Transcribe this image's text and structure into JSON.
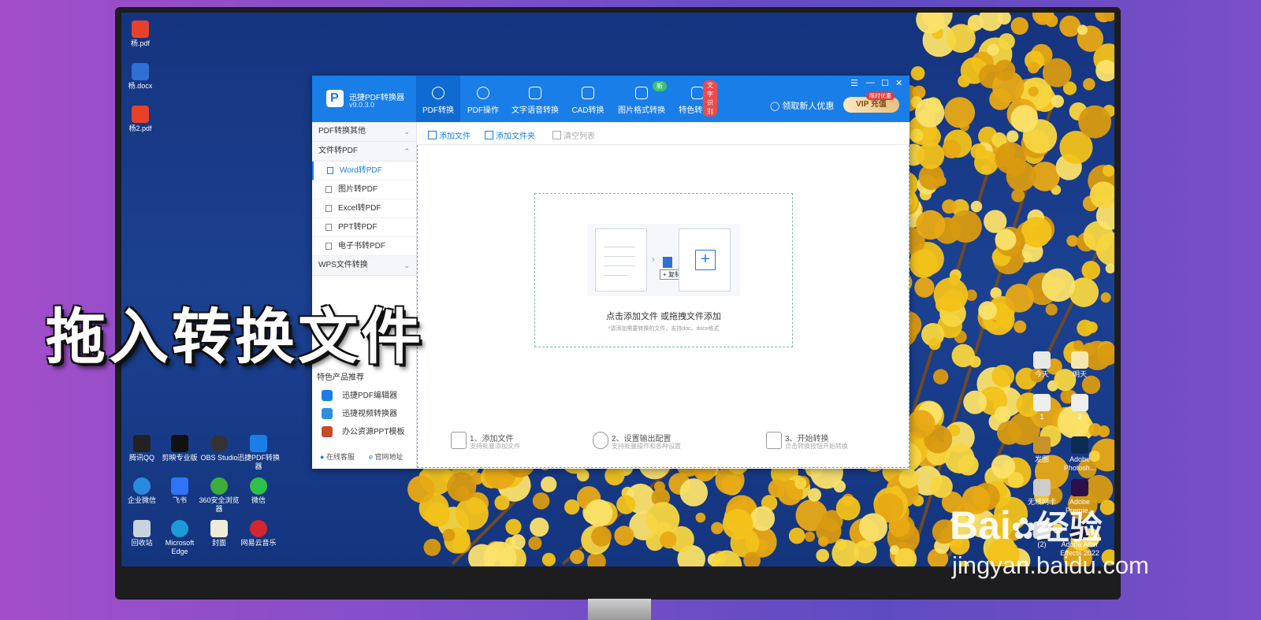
{
  "overlay": {
    "headline": "拖入转换文件"
  },
  "watermark": {
    "logo": "Bai",
    "logo_cn": "经验",
    "url": "jingyan.baidu.com"
  },
  "desktop": {
    "top_icons": [
      {
        "label": "杨.pdf",
        "color": "#e8412b"
      },
      {
        "label": "杨.docx",
        "color": "#2f6fd6"
      },
      {
        "label": "杨2.pdf",
        "color": "#e8412b"
      }
    ],
    "bottom_icons": [
      {
        "label": "腾讯QQ",
        "color": "#222222"
      },
      {
        "label": "剪映专业版",
        "color": "#111111"
      },
      {
        "label": "OBS Studio",
        "color": "#333333"
      },
      {
        "label": "迅捷PDF转换器",
        "color": "#1a7ee8"
      },
      {
        "label": "企业微信",
        "color": "#2a8ae0"
      },
      {
        "label": "飞书",
        "color": "#2f74f5"
      },
      {
        "label": "360安全浏览器",
        "color": "#3dae3a"
      },
      {
        "label": "微信",
        "color": "#2ec14a"
      },
      {
        "label": "回收站",
        "color": "#c9d3de"
      },
      {
        "label": "Microsoft Edge",
        "color": "#1c9ad6"
      },
      {
        "label": "封面",
        "color": "#f0ead8"
      },
      {
        "label": "网易云音乐",
        "color": "#d3262f"
      }
    ],
    "right_icons": [
      {
        "label": "今天",
        "color": "#e8e8e8"
      },
      {
        "label": "明天",
        "color": "#f4e7b0"
      },
      {
        "label": "1",
        "color": "#eeeeee"
      },
      {
        "label": "2",
        "color": "#eeeeee"
      },
      {
        "label": "发图",
        "color": "#c8922a"
      },
      {
        "label": "Adobe Photosh...",
        "color": "#0d2c52"
      },
      {
        "label": "无线网卡",
        "color": "#cccccc"
      },
      {
        "label": "Adobe Premie...",
        "color": "#2a0f4a"
      },
      {
        "label": "(2)",
        "color": "#dddddd"
      },
      {
        "label": "Adobe After Effects 2022",
        "color": "#1a1b47"
      }
    ]
  },
  "app": {
    "name": "迅捷PDF转换器",
    "version": "v9.0.3.0",
    "nav": [
      {
        "label": "PDF转换"
      },
      {
        "label": "PDF操作"
      },
      {
        "label": "文字语音转换"
      },
      {
        "label": "CAD转换"
      },
      {
        "label": "图片格式转换"
      },
      {
        "label": "特色转换"
      }
    ],
    "badge_new": "新",
    "badge_ocr": "文字识别",
    "promo": "领取新人优惠",
    "vip_label": "VIP 充值",
    "vip_tag": "限时优惠",
    "window_controls": {
      "menu": "☰",
      "min": "—",
      "max": "☐",
      "close": "✕"
    },
    "sidebar": {
      "sec1": "PDF转换其他",
      "sec2": "文件转PDF",
      "sub": [
        "Word转PDF",
        "图片转PDF",
        "Excel转PDF",
        "PPT转PDF",
        "电子书转PDF"
      ],
      "sec3": "WPS文件转换",
      "featured_title": "特色产品推荐",
      "featured": [
        "迅捷PDF编辑器",
        "迅捷视频转换器",
        "办公资源PPT模板"
      ],
      "link_service": "在线客服",
      "link_site": "官网地址"
    },
    "toolbar": {
      "add_file": "添加文件",
      "add_folder": "添加文件夹",
      "clear": "清空列表"
    },
    "drop": {
      "copy_tip": "+ 复制",
      "hint": "点击添加文件 或拖拽文件添加",
      "sub": "*请添加需要转换的文件，支持doc、docx格式"
    },
    "steps": [
      {
        "title": "1、添加文件",
        "sub": "支持批量添加文件"
      },
      {
        "title": "2、设置输出配置",
        "sub": "支持批量操作和各种设置"
      },
      {
        "title": "3、开始转换",
        "sub": "点击转换按钮开始转换"
      }
    ]
  }
}
